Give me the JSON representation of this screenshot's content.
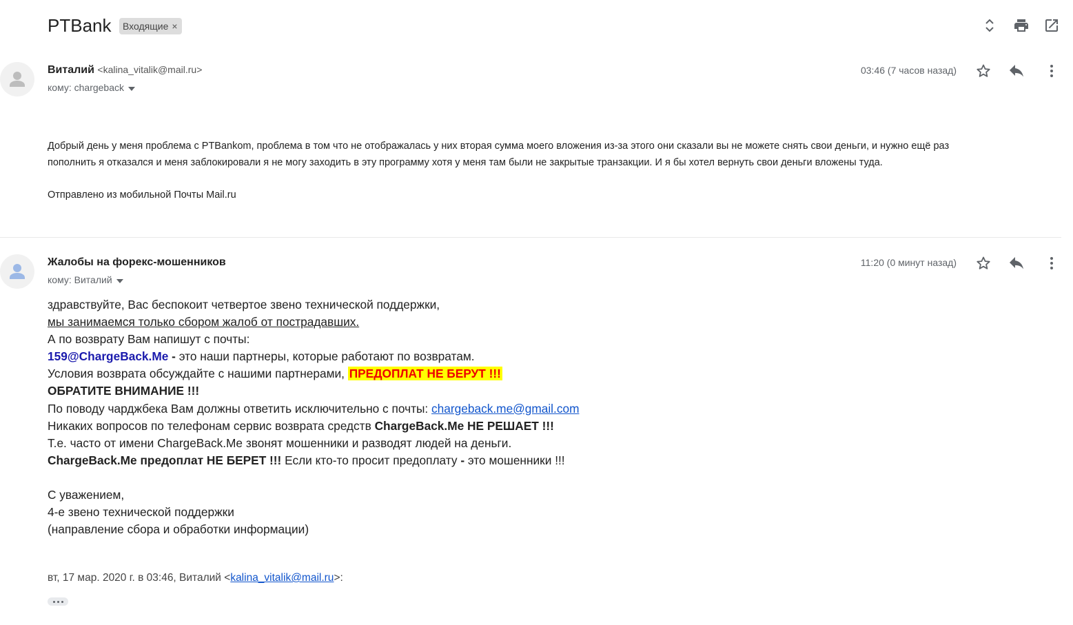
{
  "header": {
    "subject": "PTBank",
    "label": "Входящие",
    "label_remove": "×",
    "icons": [
      "expand-collapse-icon",
      "print-icon",
      "open-in-new-window-icon"
    ]
  },
  "messages": [
    {
      "sender_name": "Виталий",
      "sender_email": "<kalina_vitalik@mail.ru>",
      "to": "кому: chargeback",
      "time": "03:46 (7 часов назад)",
      "body_lines": [
        "Добрый день у меня проблема с PTBankom, проблема в том что не отображалась у них вторая сумма моего вложения из-за этого они сказали вы не можете снять свои деньги, и нужно ещё раз",
        "пополнить я отказался и меня заблокировали я не могу заходить в эту программу хотя у меня там были не закрытые транзакции. И я бы хотел вернуть свои деньги вложены туда."
      ],
      "signature": "Отправлено из мобильной Почты Mail.ru"
    },
    {
      "sender_name": "Жалобы на форекс-мошенников",
      "to": "кому: Виталий",
      "time": "11:20 (0 минут назад)",
      "body": {
        "l1": "здравствуйте, Вас беспокоит четвертое звено технической поддержки,",
        "l2": "мы занимаемся только сбором жалоб от пострадавших.",
        "l3": "А по возврату Вам напишут с почты:",
        "l4_email": "159@ChargeBack.Me",
        "l4_dash": " - ",
        "l4_rest": "это наши партнеры, которые работают по возвратам.",
        "l5_text": "Условия возврата обсуждайте с нашими партнерами, ",
        "l5_highlight": "ПРЕДОПЛАТ НЕ БЕРУТ !!!",
        "l6": "ОБРАТИТЕ ВНИМАНИЕ !!!",
        "l7_text": "По поводу чарджбека Вам должны ответить исключительно с почты: ",
        "l7_link": "chargeback.me@gmail.com",
        "l8_text": "Никаких вопросов по телефонам сервис возврата средств ",
        "l8_bold": "ChargeBack.Me НЕ РЕШАЕТ !!!",
        "l9": "Т.е. часто от имени ChargeBack.Me звонят мошенники и разводят людей на деньги.",
        "l10_bold": "ChargeBack.Me предоплат НЕ БЕРЕТ !!!",
        "l10_text": " Если кто-то просит предоплату ",
        "l10_dash": "-",
        "l10_tail": " это мошенники !!!",
        "sig1": "С уважением,",
        "sig2": "4-е звено технической поддержки",
        "sig3": "(направление сбора и обработки информации)"
      },
      "quote_prefix": "вт, 17 мар. 2020 г. в 03:46, Виталий <",
      "quote_email": "kalina_vitalik@mail.ru",
      "quote_suffix": ">:"
    }
  ],
  "colors": {
    "link": "#1155cc",
    "highlight_bg": "#ffff00",
    "highlight_text": "#ee0000",
    "partner_email": "#1a1aad"
  }
}
